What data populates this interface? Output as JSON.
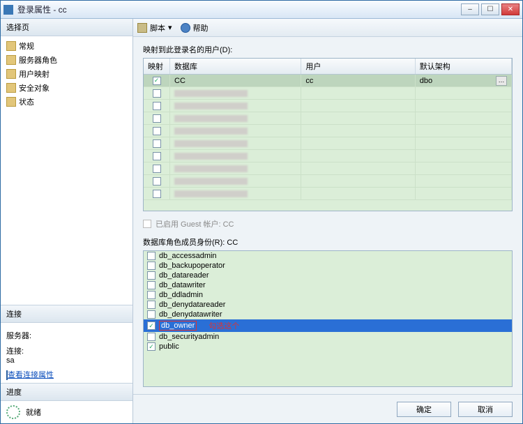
{
  "window": {
    "title": "登录属性 - cc"
  },
  "winbtns": {
    "min": "–",
    "max": "☐",
    "close": "✕"
  },
  "sidebar": {
    "select_page_header": "选择页",
    "items": [
      {
        "label": "常规"
      },
      {
        "label": "服务器角色"
      },
      {
        "label": "用户映射"
      },
      {
        "label": "安全对象"
      },
      {
        "label": "状态"
      }
    ],
    "connection_header": "连接",
    "server_label": "服务器:",
    "server_value": " ",
    "conn_label": "连接:",
    "conn_value": "sa",
    "view_conn_props": "查看连接属性",
    "progress_header": "进度",
    "progress_status": "就绪"
  },
  "toolbar": {
    "script": "脚本",
    "help": "帮助"
  },
  "mapping": {
    "label": "映射到此登录名的用户(D):",
    "cols": {
      "map": "映射",
      "db": "数据库",
      "user": "用户",
      "schema": "默认架构"
    },
    "rows": [
      {
        "checked": true,
        "db": "CC",
        "user": "cc",
        "schema": "dbo",
        "selected": true
      },
      {
        "checked": false
      },
      {
        "checked": false
      },
      {
        "checked": false
      },
      {
        "checked": false
      },
      {
        "checked": false
      },
      {
        "checked": false
      },
      {
        "checked": false
      },
      {
        "checked": false
      },
      {
        "checked": false
      }
    ]
  },
  "guest": {
    "label": "已启用 Guest 帐户: CC"
  },
  "roles": {
    "label": "数据库角色成员身份(R): CC",
    "items": [
      {
        "name": "db_accessadmin",
        "checked": false
      },
      {
        "name": "db_backupoperator",
        "checked": false
      },
      {
        "name": "db_datareader",
        "checked": false
      },
      {
        "name": "db_datawriter",
        "checked": false
      },
      {
        "name": "db_ddladmin",
        "checked": false
      },
      {
        "name": "db_denydatareader",
        "checked": false
      },
      {
        "name": "db_denydatawriter",
        "checked": false
      },
      {
        "name": "db_owner",
        "checked": true,
        "selected": true,
        "highlightBox": true
      },
      {
        "name": "db_securityadmin",
        "checked": false
      },
      {
        "name": "public",
        "checked": true
      }
    ],
    "annotation": "勾选这个"
  },
  "footer": {
    "ok": "确定",
    "cancel": "取消"
  }
}
